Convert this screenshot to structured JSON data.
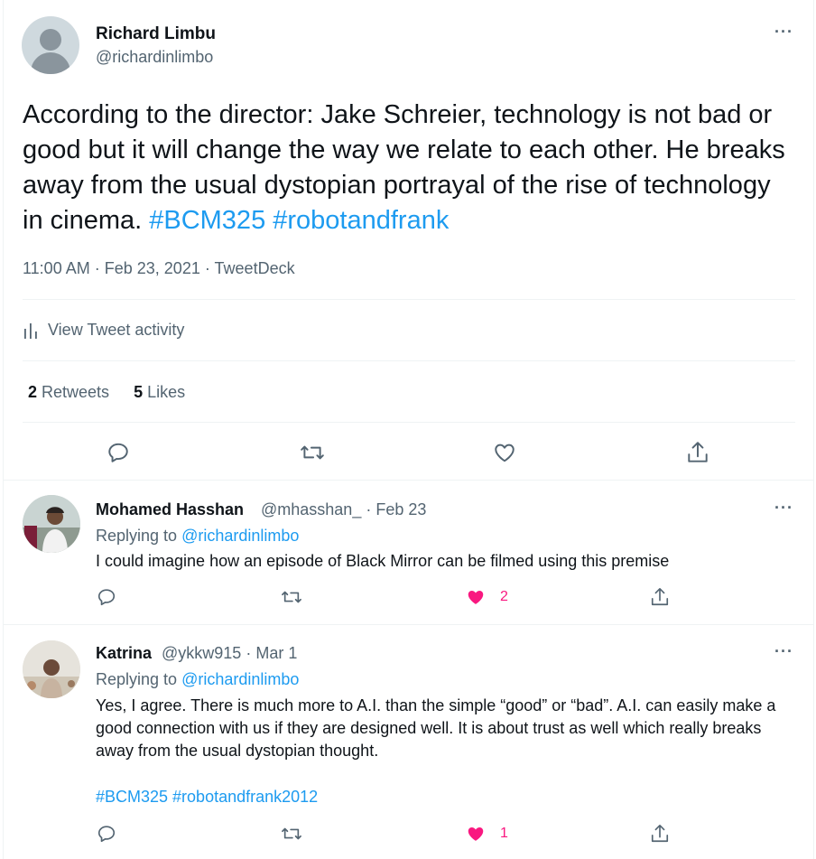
{
  "main_tweet": {
    "author_name": "Richard Limbu",
    "author_handle": "@richardinlimbo",
    "text": "According to the director: Jake Schreier, technology is not bad or good but it will change the way we relate to each other. He breaks away from the usual dystopian portrayal of the rise of technology in cinema.",
    "hashtags": [
      "#BCM325",
      "#robotandfrank"
    ],
    "time": "11:00 AM",
    "date": "Feb 23, 2021",
    "source": "TweetDeck",
    "activity_label": "View Tweet activity",
    "retweets_count": "2",
    "retweets_label": "Retweets",
    "likes_count": "5",
    "likes_label": "Likes"
  },
  "replies": [
    {
      "name": "Mohamed Hasshan",
      "handle": "@mhasshan_",
      "date": "Feb 23",
      "replying_prefix": "Replying to",
      "replying_to": "@richardinlimbo",
      "text": "I could imagine how an episode of Black Mirror can be filmed using this premise",
      "likes": "2"
    },
    {
      "name": "Katrina",
      "handle": "@ykkw915",
      "date": "Mar 1",
      "replying_prefix": "Replying to",
      "replying_to": "@richardinlimbo",
      "text": "Yes, I agree. There is much more to A.I. than the simple “good” or “bad”. A.I. can easily make a good connection with us if they are designed well. It is about trust as well which really breaks away from the usual dystopian thought.",
      "hashtags": "#BCM325 #robotandfrank2012",
      "likes": "1"
    }
  ],
  "icons": {
    "more": "more-icon",
    "reply": "reply-icon",
    "retweet": "retweet-icon",
    "like": "like-icon",
    "share": "share-icon",
    "activity": "activity-icon"
  },
  "separators": {
    "dot": "·"
  },
  "colors": {
    "accent": "#1d9bf0",
    "like": "#f91880",
    "muted": "#536471",
    "text": "#0f1419"
  },
  "more_glyph": "···"
}
